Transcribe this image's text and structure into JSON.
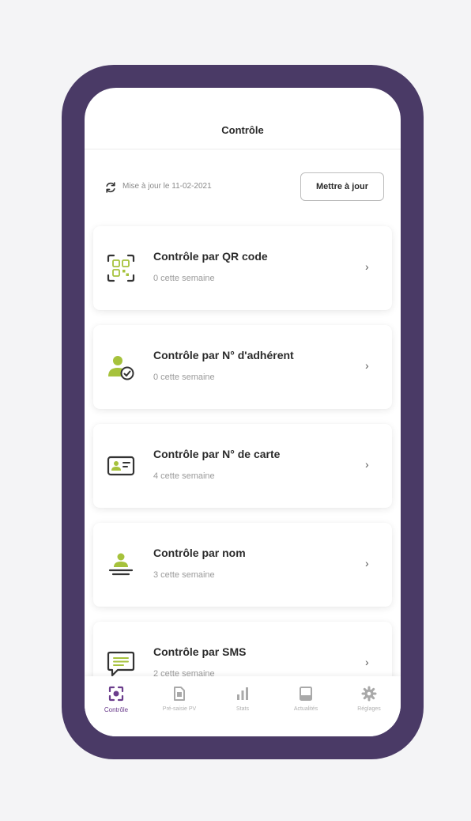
{
  "header": {
    "title": "Contrôle"
  },
  "update": {
    "text": "Mise à jour le 11-02-2021",
    "button_label": "Mettre à jour"
  },
  "cards": [
    {
      "title": "Contrôle par QR code",
      "subtitle": "0 cette semaine",
      "icon": "qr-code-icon"
    },
    {
      "title": "Contrôle par N° d'adhérent",
      "subtitle": "0 cette semaine",
      "icon": "member-check-icon"
    },
    {
      "title": "Contrôle par N° de carte",
      "subtitle": "4 cette semaine",
      "icon": "id-card-icon"
    },
    {
      "title": "Contrôle par nom",
      "subtitle": "3 cette semaine",
      "icon": "person-name-icon"
    },
    {
      "title": "Contrôle par SMS",
      "subtitle": "2 cette semaine",
      "icon": "sms-icon"
    }
  ],
  "chevron": "›",
  "nav": [
    {
      "label": "Contrôle",
      "icon": "scan-icon",
      "active": true
    },
    {
      "label": "Pré-saisie PV",
      "icon": "document-icon",
      "active": false
    },
    {
      "label": "Stats",
      "icon": "bar-chart-icon",
      "active": false
    },
    {
      "label": "Actualités",
      "icon": "news-icon",
      "active": false
    },
    {
      "label": "Réglages",
      "icon": "gear-icon",
      "active": false
    }
  ],
  "colors": {
    "frame": "#4a3a66",
    "accent_green": "#a6c23c",
    "accent_purple": "#6b3d8c"
  }
}
